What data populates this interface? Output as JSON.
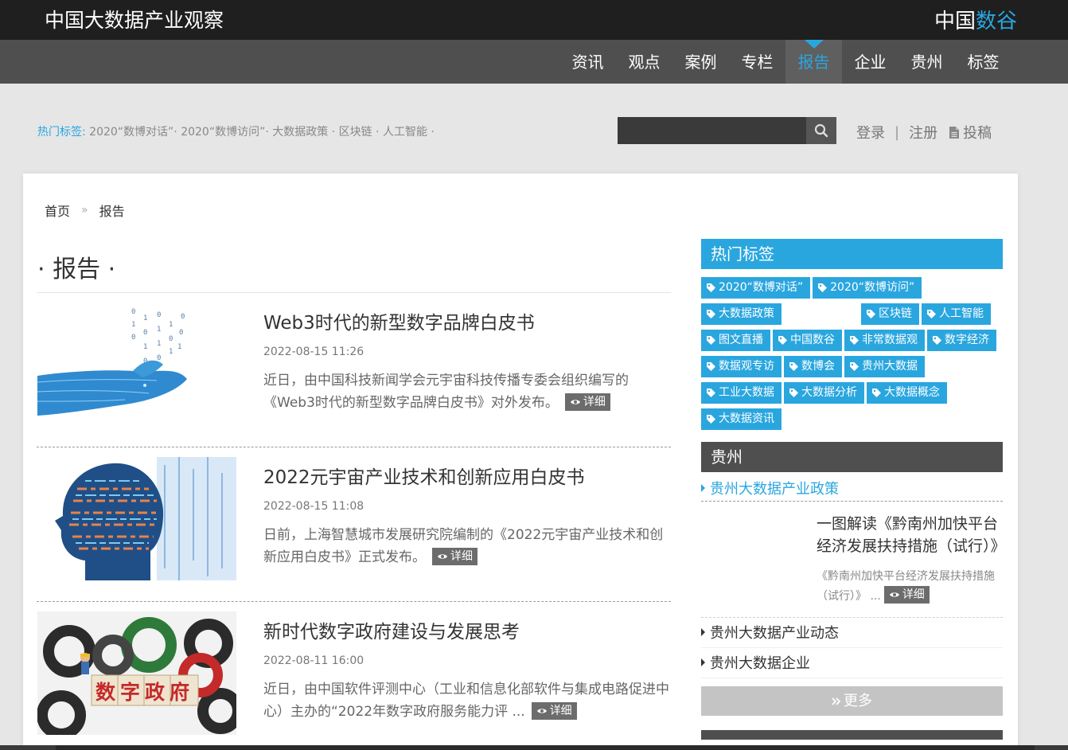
{
  "header": {
    "site_title": "中国大数据产业观察",
    "brand_a": "中国",
    "brand_b": "数谷"
  },
  "nav": [
    "资讯",
    "观点",
    "案例",
    "专栏",
    "报告",
    "企业",
    "贵州",
    "标签"
  ],
  "hot": {
    "label": "热门标签:",
    "text": "2020“数博对话”· 2020“数博访问”· 大数据政策 · 区块链 · 人工智能 ·"
  },
  "search": {
    "placeholder": ""
  },
  "user": {
    "login": "登录",
    "sep": "|",
    "register": "注册",
    "submit": "投稿"
  },
  "breadcrumb": {
    "home": "首页",
    "sep": "»",
    "current": "报告"
  },
  "page": {
    "heading": "· 报告 ·"
  },
  "articles": [
    {
      "title": "Web3时代的新型数字品牌白皮书",
      "date": "2022-08-15 11:26",
      "summary": "近日，由中国科技新闻学会元宇宙科技传播专委会组织编写的《Web3时代的新型数字品牌白皮书》对外发布。",
      "detail": "详细"
    },
    {
      "title": "2022元宇宙产业技术和创新应用白皮书",
      "date": "2022-08-15 11:08",
      "summary": "日前，上海智慧城市发展研究院编制的《2022元宇宙产业技术和创新应用白皮书》正式发布。",
      "detail": "详细"
    },
    {
      "title": "新时代数字政府建设与发展思考",
      "date": "2022-08-11 16:00",
      "summary": "近日，由中国软件评测中心（工业和信息化部软件与集成电路促进中心）主办的“2022年数字政府服务能力评 ...",
      "detail": "详细",
      "thumb_text": "数字政府"
    }
  ],
  "sidebar": {
    "hot_title": "热门标签",
    "tags": [
      "2020“数博对话”",
      "2020“数博访问”",
      "大数据政策",
      "区块链",
      "人工智能",
      "图文直播",
      "中国数谷",
      "非常数据观",
      "数字经济",
      "数据观专访",
      "数博会",
      "贵州大数据",
      "工业大数据",
      "大数据分析",
      "大数据概念",
      "大数据资讯"
    ],
    "gz_title": "贵州",
    "gz_active": "贵州大数据产业政策",
    "gz_feature_title": "一图解读《黔南州加快平台经济发展扶持措施（试行）》",
    "gz_feature_summary": "《黔南州加快平台经济发展扶持措施（试行）》 ...",
    "gz_feature_detail": "详细",
    "gz_items": [
      "贵州大数据产业动态",
      "贵州大数据企业"
    ],
    "more": "更多"
  },
  "colors": {
    "accent": "#2aa6df",
    "topbar": "#1f1f1f",
    "navbar": "#4f4f4f"
  }
}
